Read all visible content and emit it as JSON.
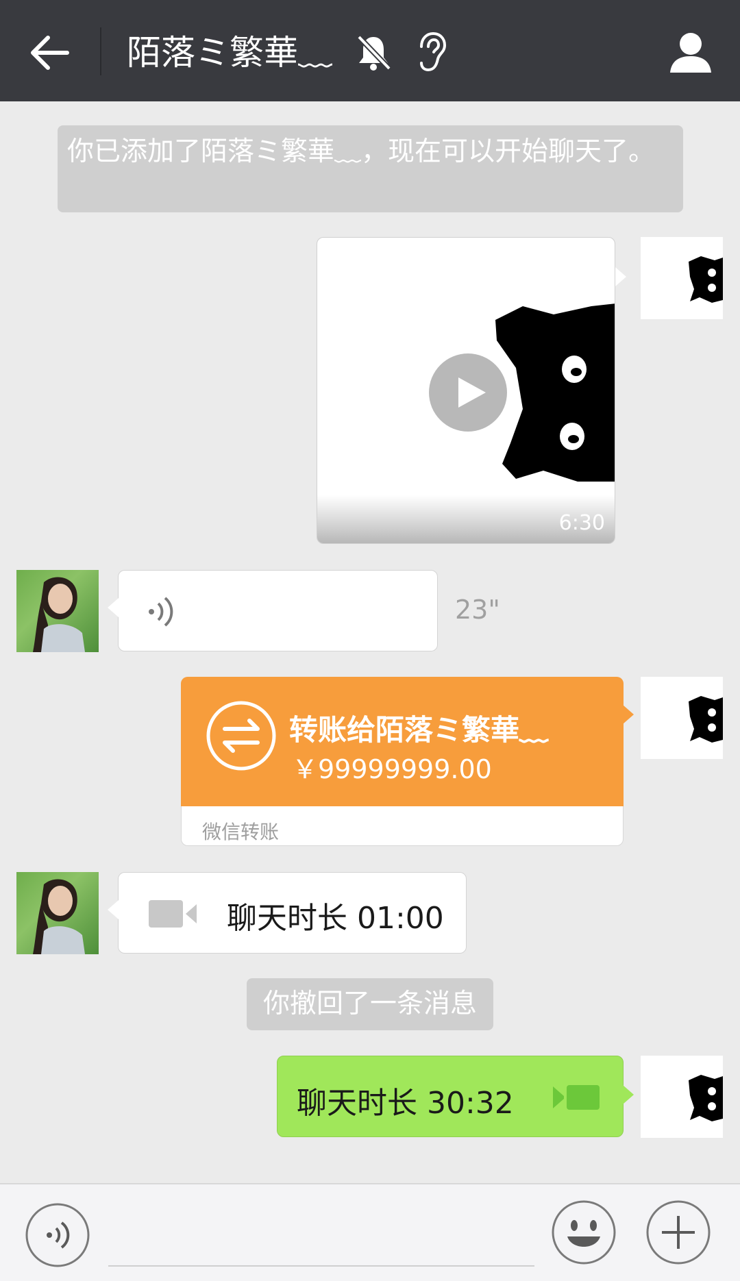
{
  "header": {
    "title": "陌落ミ繁華﹏"
  },
  "notices": {
    "added": "你已添加了陌落ミ繁華﹏，现在可以开始聊天了。",
    "recall": "你撤回了一条消息"
  },
  "messages": {
    "video": {
      "duration": "6:30"
    },
    "voice": {
      "duration": "23\""
    },
    "transfer": {
      "title": "转账给陌落ミ繁華﹏",
      "amount": "￥99999999.00",
      "label": "微信转账"
    },
    "call_in": {
      "text": "聊天时长 01:00"
    },
    "call_out": {
      "text": "聊天时长 30:32"
    }
  },
  "colors": {
    "header": "#393a3f",
    "background": "#ebebeb",
    "transfer": "#f79d3c",
    "sent_bubble": "#a0e75a"
  },
  "icons": {
    "back": "arrow-left-icon",
    "mute": "bell-off-icon",
    "earpiece": "ear-icon",
    "profile": "person-icon",
    "play": "play-icon",
    "voice": "sound-wave-icon",
    "transfer": "transfer-arrows-icon",
    "video_call": "video-camera-icon",
    "emoji": "smiley-icon",
    "more": "plus-icon"
  }
}
